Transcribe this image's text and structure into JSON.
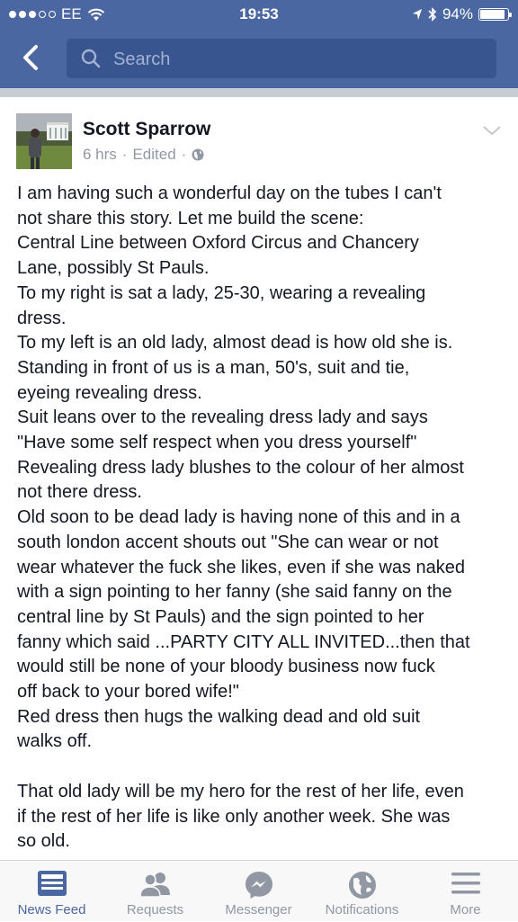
{
  "status": {
    "carrier": "EE",
    "time": "19:53",
    "battery": "94%",
    "battery_level": 0.94,
    "signal_bars_filled": 3,
    "signal_bars_total": 5,
    "icons": [
      "wifi-icon",
      "location-icon",
      "bluetooth-icon",
      "battery-icon"
    ]
  },
  "nav": {
    "search_placeholder": "Search",
    "back_icon": "chevron-left-icon"
  },
  "post": {
    "author": "Scott Sparrow",
    "time": "6 hrs",
    "sep1": "·",
    "edited": "Edited",
    "sep2": "·",
    "privacy_icon": "globe-icon",
    "menu_icon": "chevron-down-icon",
    "body": "I am having such a wonderful day on the tubes I can't\nnot share this story. Let me build the scene:\nCentral Line between Oxford Circus and Chancery\nLane, possibly St Pauls.\nTo my right is sat a lady, 25-30, wearing a revealing\ndress.\nTo my left is an old lady, almost dead is how old she is.\nStanding in front of us is a man, 50's, suit and tie,\neyeing revealing dress.\nSuit leans over to the revealing dress lady and says\n\"Have some self respect when you dress yourself\"\nRevealing dress lady blushes to the colour of her almost\nnot there dress.\nOld soon to be dead lady is having none of this and in a\nsouth london accent shouts out \"She can wear or not\nwear whatever the fuck she likes, even if she was naked\nwith a sign pointing to her fanny (she said fanny on the\ncentral line by St Pauls) and the sign pointed to her\nfanny which said ...PARTY CITY ALL INVITED...then that\nwould still be none of your bloody business now fuck\noff back to your bored wife!\"\nRed dress then hugs the walking dead and old suit\nwalks off.\n\nThat old lady will be my hero for the rest of her life, even\nif the rest of her life is like only another week. She was\nso old."
  },
  "tabs": [
    {
      "label": "News Feed",
      "icon": "news-feed-icon",
      "active": true
    },
    {
      "label": "Requests",
      "icon": "friend-requests-icon",
      "active": false
    },
    {
      "label": "Messenger",
      "icon": "messenger-icon",
      "active": false
    },
    {
      "label": "Notifications",
      "icon": "globe-notifications-icon",
      "active": false
    },
    {
      "label": "More",
      "icon": "menu-icon",
      "active": false
    }
  ],
  "colors": {
    "brand": "#4b67a1",
    "active_tab": "#4b67a1",
    "inactive_tab": "#9197a3"
  }
}
